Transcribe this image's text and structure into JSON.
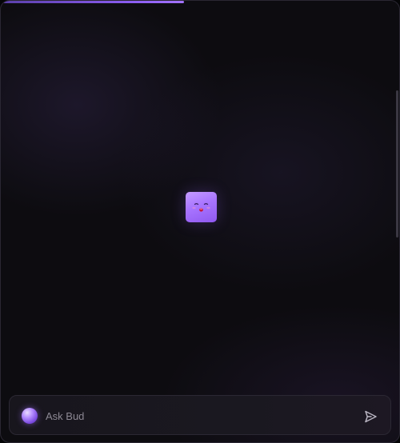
{
  "app": {
    "loading_progress": 0.46
  },
  "assistant": {
    "avatar_icon": "cute-face-mascot-icon",
    "avatar_color": "#a874ff"
  },
  "composer": {
    "placeholder": "Ask Bud",
    "value": "",
    "orb_icon": "purple-orb-icon",
    "send_icon": "send-arrow-icon"
  },
  "colors": {
    "accent": "#8a5cf0",
    "background": "#0d0c10",
    "composer_border": "#2b2833"
  }
}
